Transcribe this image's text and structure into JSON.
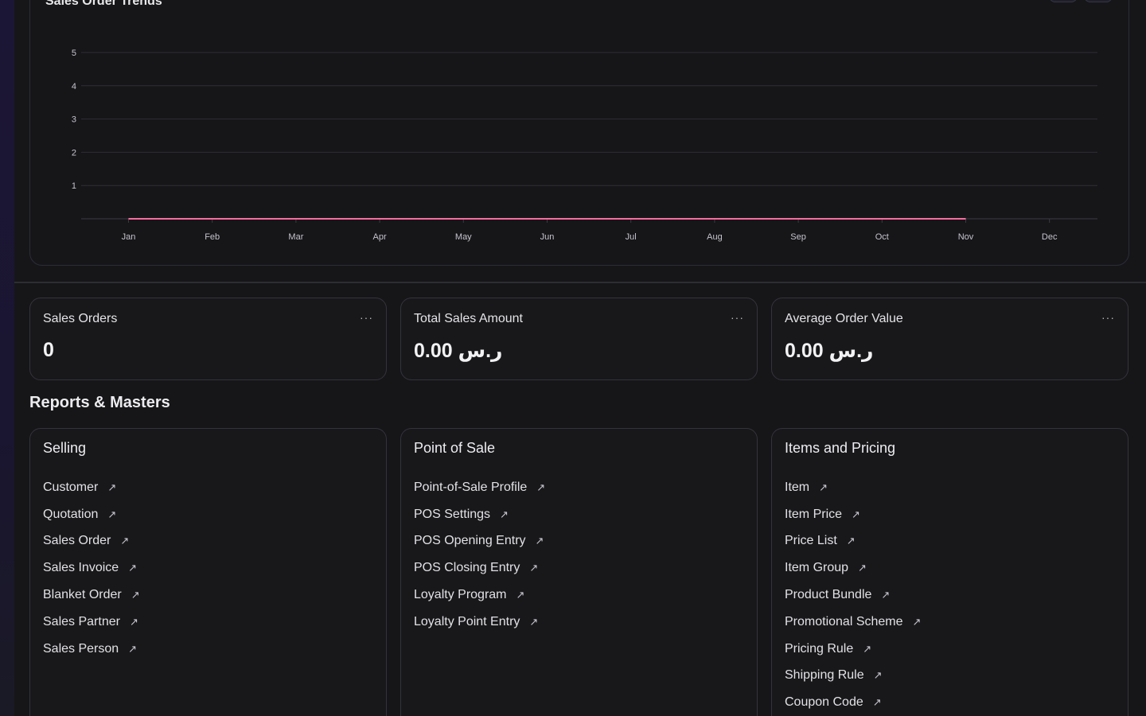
{
  "chart_data": {
    "type": "line",
    "title": "Sales Order Trends",
    "categories": [
      "Jan",
      "Feb",
      "Mar",
      "Apr",
      "May",
      "Jun",
      "Jul",
      "Aug",
      "Sep",
      "Oct",
      "Nov",
      "Dec"
    ],
    "series": [
      {
        "values": [
          0,
          0,
          0,
          0,
          0,
          0,
          0,
          0,
          0,
          0,
          0
        ]
      }
    ],
    "yticks": [
      "1",
      "2",
      "3",
      "4",
      "5"
    ],
    "ylim": [
      0,
      5
    ],
    "grid": true,
    "line_color": "#ff6b9e"
  },
  "chart_buttons": [
    "⇕",
    "···"
  ],
  "stats": [
    {
      "label": "Sales Orders",
      "value": "0",
      "more": "···"
    },
    {
      "label": "Total Sales Amount",
      "value": "0.00 ر.س",
      "more": "···"
    },
    {
      "label": "Average Order Value",
      "value": "0.00 ر.س",
      "more": "···"
    }
  ],
  "section_heading": "Reports & Masters",
  "arrow_glyph": "↗",
  "cards": [
    {
      "title": "Selling",
      "links": [
        "Customer",
        "Quotation",
        "Sales Order",
        "Sales Invoice",
        "Blanket Order",
        "Sales Partner",
        "Sales Person"
      ]
    },
    {
      "title": "Point of Sale",
      "links": [
        "Point-of-Sale Profile",
        "POS Settings",
        "POS Opening Entry",
        "POS Closing Entry",
        "Loyalty Program",
        "Loyalty Point Entry"
      ]
    },
    {
      "title": "Items and Pricing",
      "links": [
        "Item",
        "Item Price",
        "Price List",
        "Item Group",
        "Product Bundle",
        "Promotional Scheme",
        "Pricing Rule",
        "Shipping Rule",
        "Coupon Code"
      ]
    }
  ],
  "colors": {
    "accent_line": "#ff6b9e",
    "border": "#33333c",
    "background": "#161618"
  }
}
